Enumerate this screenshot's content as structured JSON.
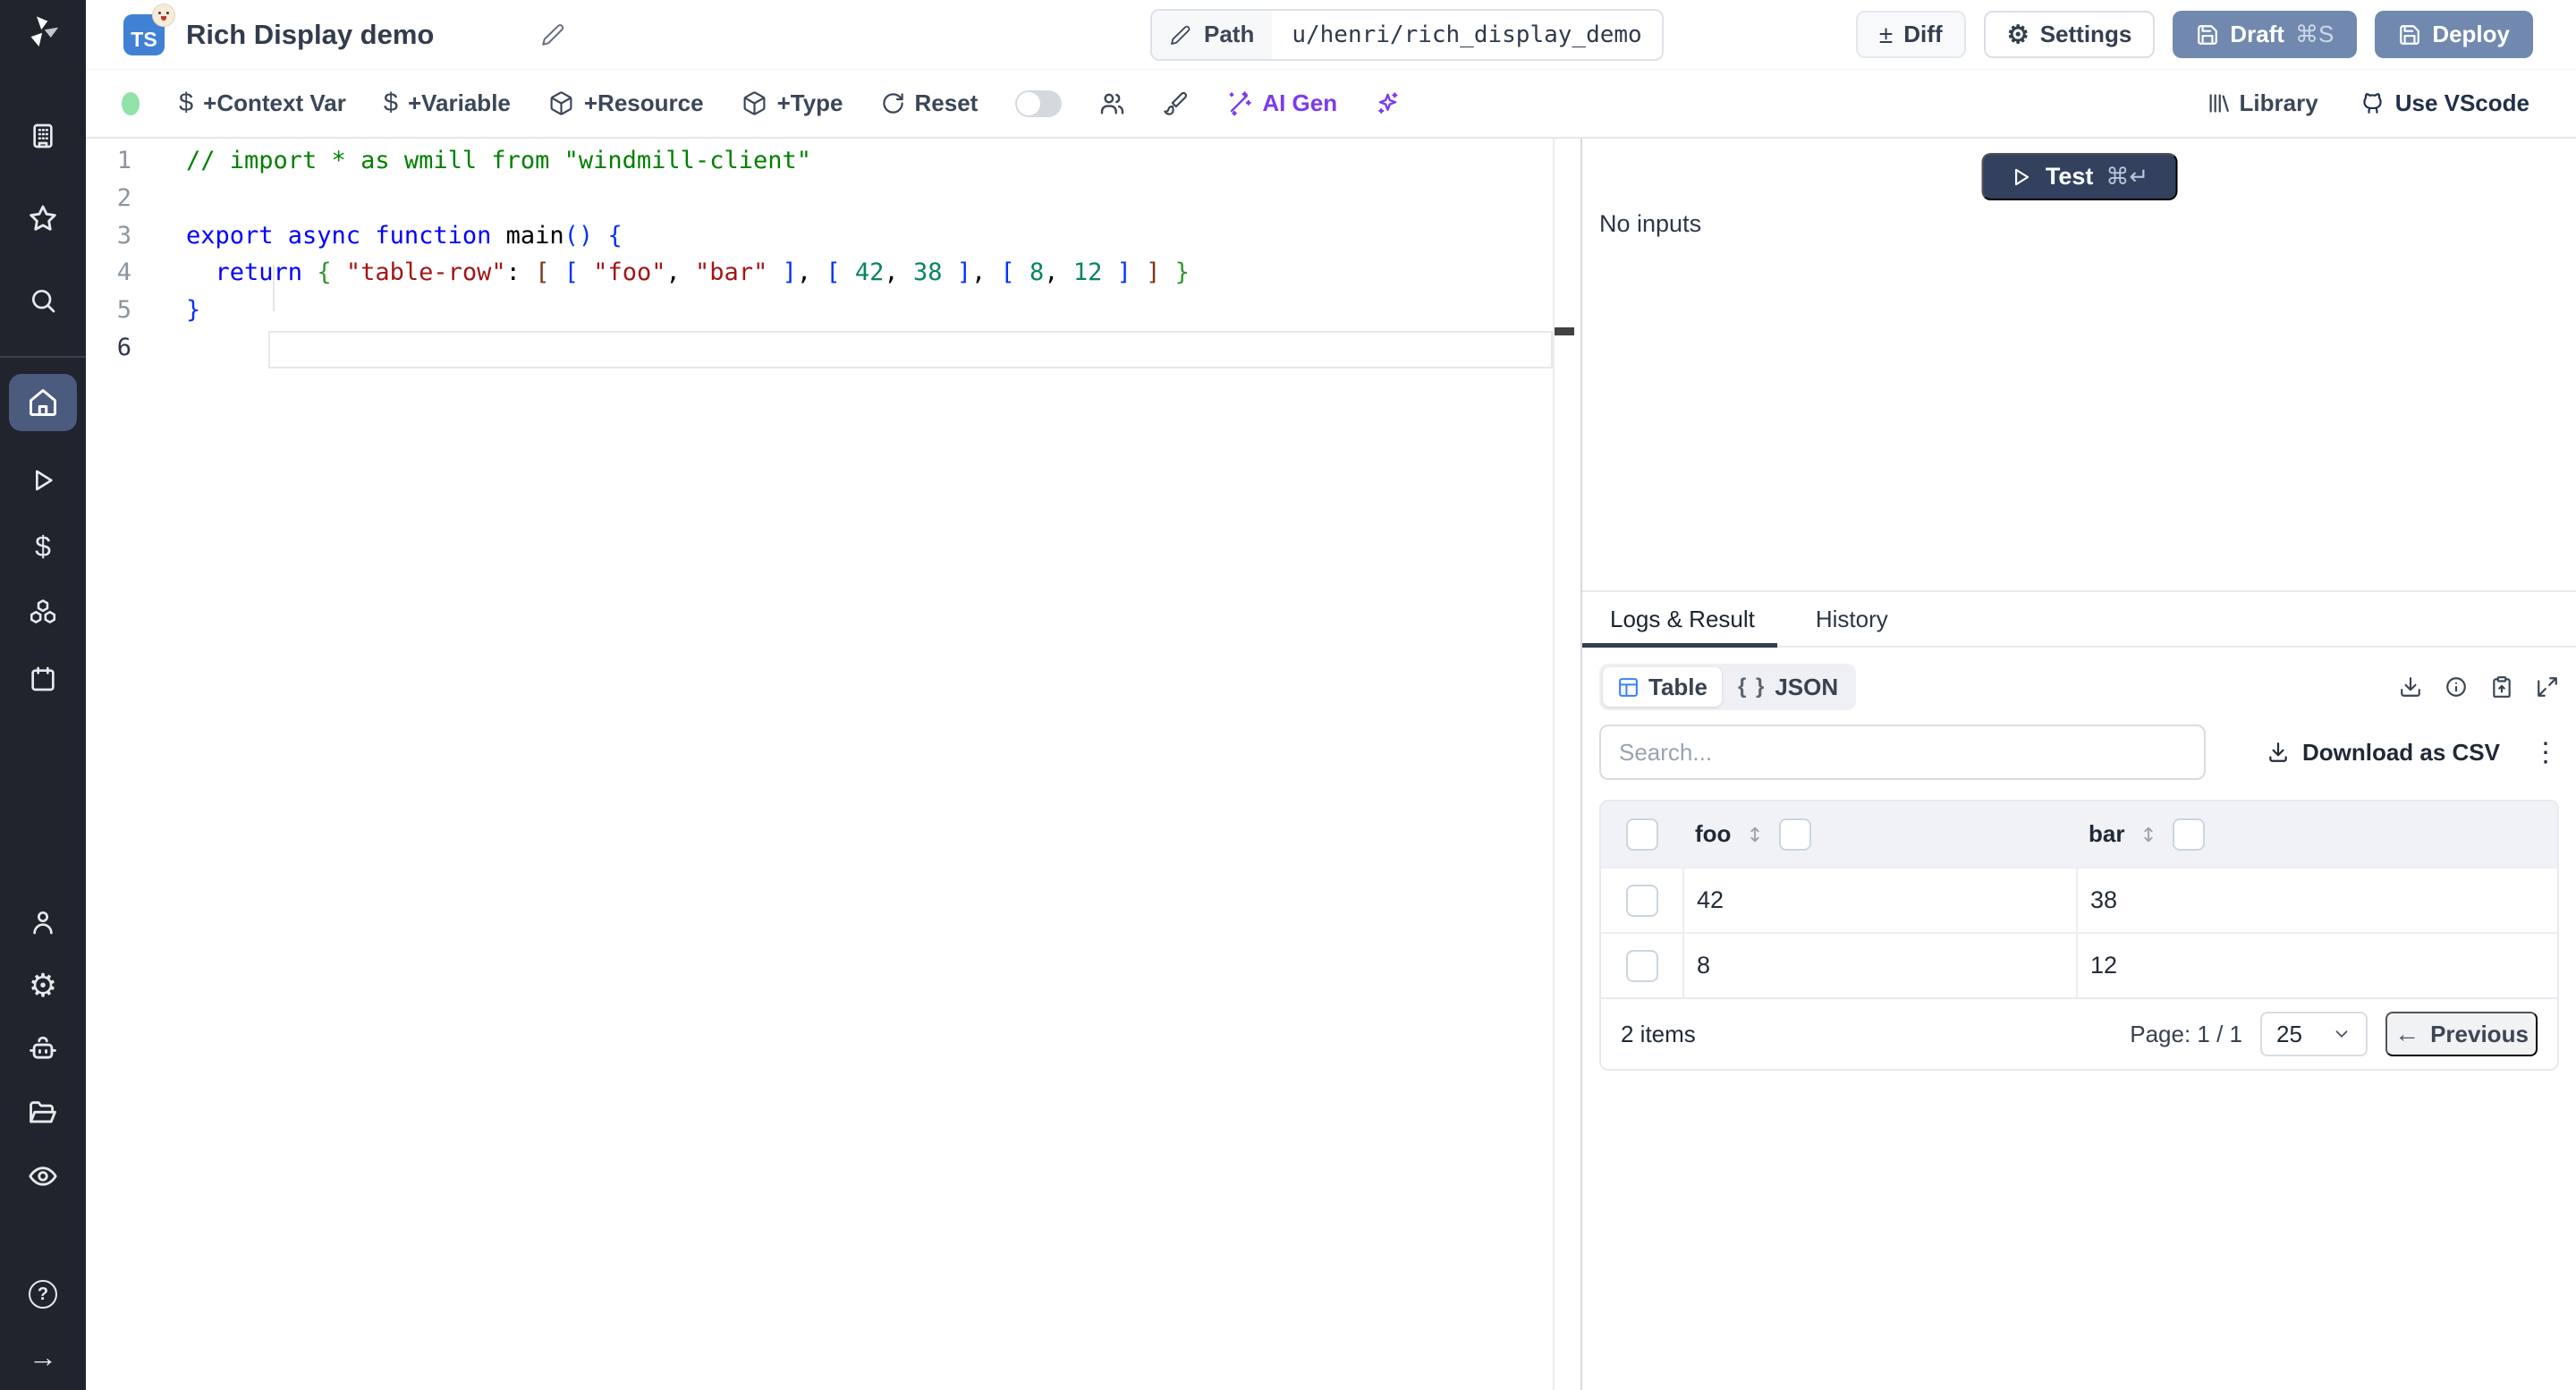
{
  "window": {
    "title": "Rich Display demo",
    "lang_badge": "TS"
  },
  "topbar": {
    "path_label": "Path",
    "path_value": "u/henri/rich_display_demo",
    "diff_label": "Diff",
    "settings_label": "Settings",
    "draft_label": "Draft",
    "draft_shortcut": "⌘S",
    "deploy_label": "Deploy"
  },
  "toolbar": {
    "context_var": "+Context Var",
    "variable": "+Variable",
    "resource": "+Resource",
    "type": "+Type",
    "reset": "Reset",
    "ai_gen": "AI Gen",
    "library": "Library",
    "use_vscode": "Use VScode"
  },
  "icons": {
    "dollar": "$",
    "plus_minus": "±",
    "gear": "⚙",
    "arrow_right": "→",
    "help": "?",
    "back_arrow": "←",
    "kebab": "⋮",
    "json_braces": "{ }"
  },
  "editor": {
    "active_line": 6,
    "lines": [
      [
        {
          "t": "// import * as wmill from \"windmill-client\"",
          "c": "comment"
        }
      ],
      [],
      [
        {
          "t": "export async function ",
          "c": "kw"
        },
        {
          "t": "main",
          "c": "plain"
        },
        {
          "t": "()",
          "c": "b-blue"
        },
        {
          "t": " ",
          "c": "plain"
        },
        {
          "t": "{",
          "c": "b-blue"
        }
      ],
      [
        {
          "t": "  ",
          "c": "plain"
        },
        {
          "t": "return",
          "c": "kw"
        },
        {
          "t": " ",
          "c": "plain"
        },
        {
          "t": "{",
          "c": "b-green"
        },
        {
          "t": " ",
          "c": "plain"
        },
        {
          "t": "\"table-row\"",
          "c": "str"
        },
        {
          "t": ": ",
          "c": "plain"
        },
        {
          "t": "[",
          "c": "b-brown"
        },
        {
          "t": " ",
          "c": "plain"
        },
        {
          "t": "[",
          "c": "b-blue"
        },
        {
          "t": " ",
          "c": "plain"
        },
        {
          "t": "\"foo\"",
          "c": "str"
        },
        {
          "t": ", ",
          "c": "plain"
        },
        {
          "t": "\"bar\"",
          "c": "str"
        },
        {
          "t": " ",
          "c": "plain"
        },
        {
          "t": "]",
          "c": "b-blue"
        },
        {
          "t": ", ",
          "c": "plain"
        },
        {
          "t": "[",
          "c": "b-blue"
        },
        {
          "t": " ",
          "c": "plain"
        },
        {
          "t": "42",
          "c": "num"
        },
        {
          "t": ", ",
          "c": "plain"
        },
        {
          "t": "38",
          "c": "num"
        },
        {
          "t": " ",
          "c": "plain"
        },
        {
          "t": "]",
          "c": "b-blue"
        },
        {
          "t": ", ",
          "c": "plain"
        },
        {
          "t": "[",
          "c": "b-blue"
        },
        {
          "t": " ",
          "c": "plain"
        },
        {
          "t": "8",
          "c": "num"
        },
        {
          "t": ", ",
          "c": "plain"
        },
        {
          "t": "12",
          "c": "num"
        },
        {
          "t": " ",
          "c": "plain"
        },
        {
          "t": "]",
          "c": "b-blue"
        },
        {
          "t": " ",
          "c": "plain"
        },
        {
          "t": "]",
          "c": "b-brown"
        },
        {
          "t": " ",
          "c": "plain"
        },
        {
          "t": "}",
          "c": "b-green"
        }
      ],
      [
        {
          "t": "}",
          "c": "b-blue"
        }
      ],
      []
    ]
  },
  "right_panel": {
    "test_label": "Test",
    "test_shortcut": "⌘↵",
    "no_inputs": "No inputs",
    "tabs": {
      "logs": "Logs & Result",
      "history": "History"
    },
    "view_toggle": {
      "table": "Table",
      "json": "JSON"
    },
    "search_placeholder": "Search...",
    "download_csv": "Download as CSV",
    "table": {
      "columns": [
        "foo",
        "bar"
      ],
      "rows": [
        [
          "42",
          "38"
        ],
        [
          "8",
          "12"
        ]
      ]
    },
    "footer": {
      "items": "2 items",
      "page": "Page: 1 / 1",
      "page_size": "25",
      "previous": "Previous"
    }
  },
  "colors": {
    "ts_badge": "#4181d3",
    "slate_button": "#7189ae",
    "test_button": "#33415f",
    "ai_purple": "#7c3aed",
    "status_green": "#90e2a8",
    "table_icon_blue": "#3b82f6",
    "sidebar_bg": "#20242d",
    "sidebar_active": "#4b5b7e",
    "syntax_comment": "#008000",
    "syntax_keyword": "#0000ff",
    "syntax_string": "#a31515",
    "syntax_number": "#098658",
    "syntax_bracket_blue": "#0431fa",
    "syntax_bracket_green": "#319331",
    "syntax_bracket_brown": "#7b3814"
  }
}
